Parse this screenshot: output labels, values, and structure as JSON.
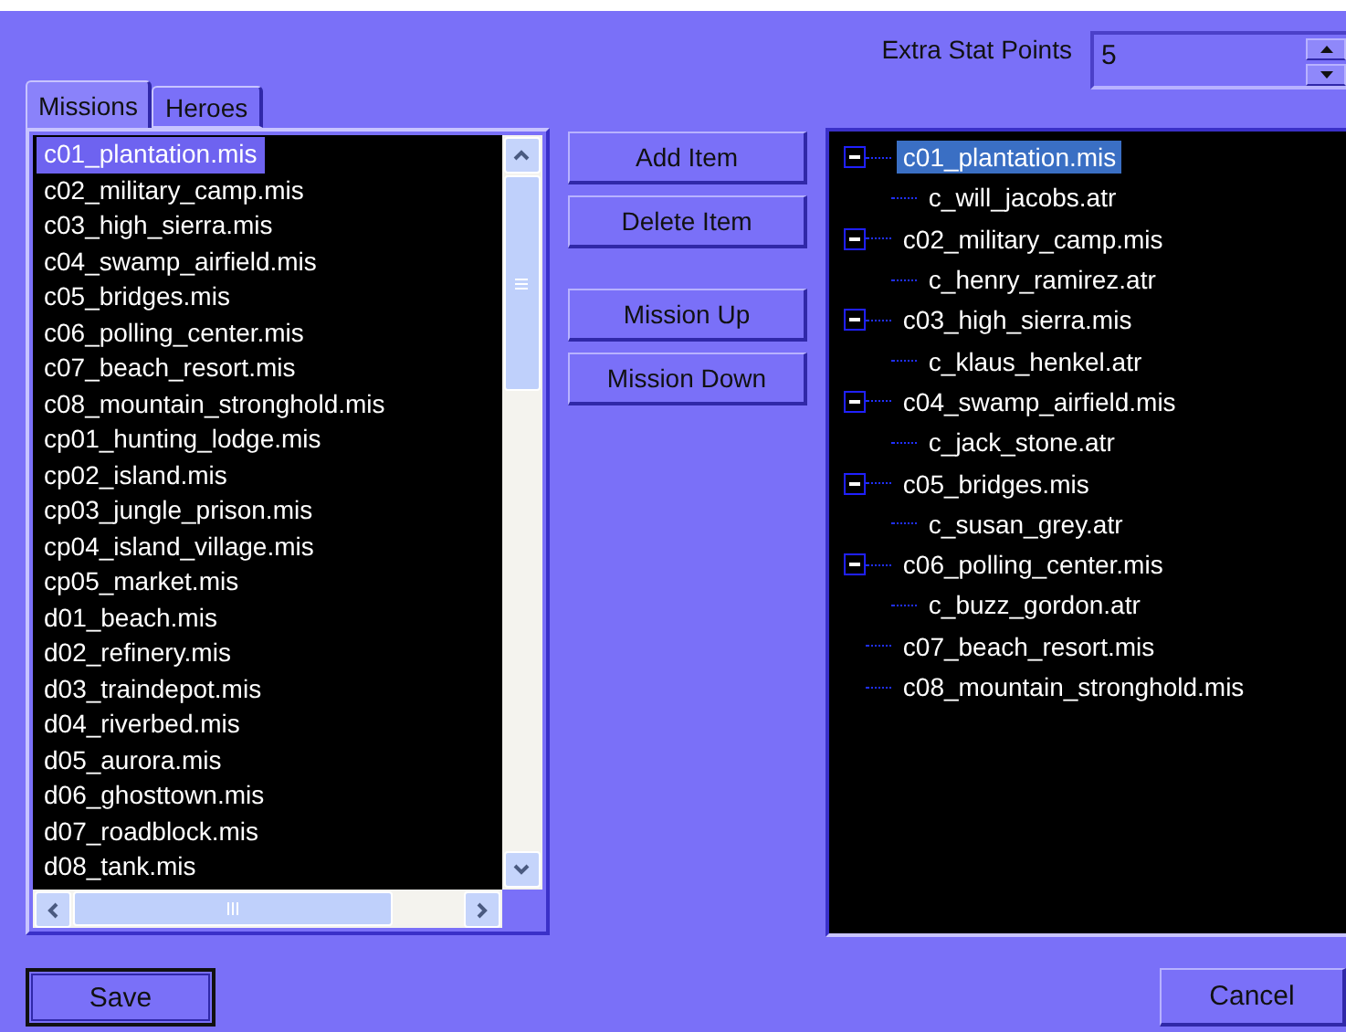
{
  "extra_stat_points": {
    "label": "Extra Stat Points",
    "value": "5"
  },
  "tabs": [
    {
      "label": "Missions",
      "selected": true
    },
    {
      "label": "Heroes",
      "selected": false
    }
  ],
  "mission_list": [
    {
      "label": "c01_plantation.mis",
      "selected": true
    },
    {
      "label": "c02_military_camp.mis",
      "selected": false
    },
    {
      "label": "c03_high_sierra.mis",
      "selected": false
    },
    {
      "label": "c04_swamp_airfield.mis",
      "selected": false
    },
    {
      "label": "c05_bridges.mis",
      "selected": false
    },
    {
      "label": "c06_polling_center.mis",
      "selected": false
    },
    {
      "label": "c07_beach_resort.mis",
      "selected": false
    },
    {
      "label": "c08_mountain_stronghold.mis",
      "selected": false
    },
    {
      "label": "cp01_hunting_lodge.mis",
      "selected": false
    },
    {
      "label": "cp02_island.mis",
      "selected": false
    },
    {
      "label": "cp03_jungle_prison.mis",
      "selected": false
    },
    {
      "label": "cp04_island_village.mis",
      "selected": false
    },
    {
      "label": "cp05_market.mis",
      "selected": false
    },
    {
      "label": "d01_beach.mis",
      "selected": false
    },
    {
      "label": "d02_refinery.mis",
      "selected": false
    },
    {
      "label": "d03_traindepot.mis",
      "selected": false
    },
    {
      "label": "d04_riverbed.mis",
      "selected": false
    },
    {
      "label": "d05_aurora.mis",
      "selected": false
    },
    {
      "label": "d06_ghosttown.mis",
      "selected": false
    },
    {
      "label": "d07_roadblock.mis",
      "selected": false
    },
    {
      "label": "d08_tank.mis",
      "selected": false
    }
  ],
  "action_buttons": [
    [
      "Add Item",
      "Delete Item"
    ],
    [
      "Mission Up",
      "Mission Down"
    ]
  ],
  "tree": [
    {
      "label": "c01_plantation.mis",
      "selected": true,
      "expanded": true,
      "children": [
        {
          "label": "c_will_jacobs.atr",
          "selected": false
        }
      ]
    },
    {
      "label": "c02_military_camp.mis",
      "selected": false,
      "expanded": true,
      "children": [
        {
          "label": "c_henry_ramirez.atr",
          "selected": false
        }
      ]
    },
    {
      "label": "c03_high_sierra.mis",
      "selected": false,
      "expanded": true,
      "children": [
        {
          "label": "c_klaus_henkel.atr",
          "selected": false
        }
      ]
    },
    {
      "label": "c04_swamp_airfield.mis",
      "selected": false,
      "expanded": true,
      "children": [
        {
          "label": "c_jack_stone.atr",
          "selected": false
        }
      ]
    },
    {
      "label": "c05_bridges.mis",
      "selected": false,
      "expanded": true,
      "children": [
        {
          "label": "c_susan_grey.atr",
          "selected": false
        }
      ]
    },
    {
      "label": "c06_polling_center.mis",
      "selected": false,
      "expanded": true,
      "children": [
        {
          "label": "c_buzz_gordon.atr",
          "selected": false
        }
      ]
    },
    {
      "label": "c07_beach_resort.mis",
      "selected": false
    },
    {
      "label": "c08_mountain_stronghold.mis",
      "selected": false
    }
  ],
  "save_button": "Save",
  "cancel_button": "Cancel"
}
